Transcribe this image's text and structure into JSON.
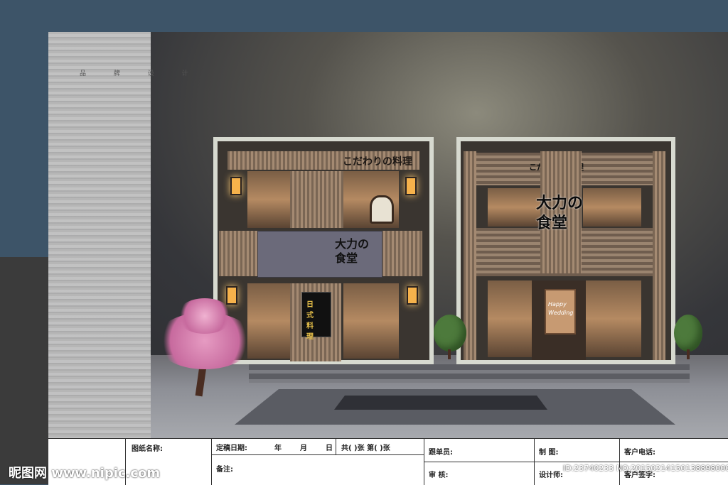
{
  "brand_strip_text": "品 牌 设 计",
  "left_store": {
    "banner_text": "こだわりの料理",
    "sign_text": "大力の食堂",
    "poster_text": "日式料理"
  },
  "right_store": {
    "banner_text": "こだわりの料理",
    "sign_text": "大力の食堂",
    "scroll_text": "Happy Wedding"
  },
  "title_block": {
    "drawing_name_label": "图纸名称:",
    "date_label": "定稿日期:",
    "year": "年",
    "month": "月",
    "day": "日",
    "sheets_label": "共(  )张 第(  )张",
    "follow_label": "跟单员:",
    "draw_label": "制    图:",
    "phone_label": "客户电话:",
    "note_label": "备注:",
    "review_label": "审    核:",
    "designer_label": "设计师:",
    "sign_label": "客户签字:"
  },
  "watermark": {
    "site": "昵图网 www.nipic.com",
    "id": "ID:23740233 NO:20150214150138898000"
  }
}
